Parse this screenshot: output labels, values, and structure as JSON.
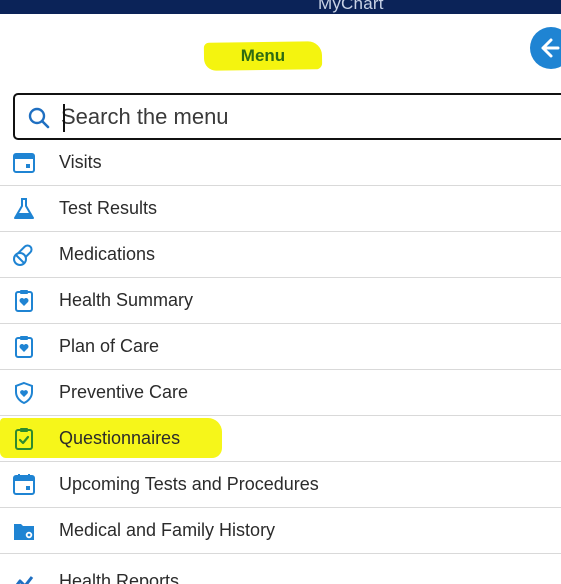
{
  "header": {
    "brand": "MyChart"
  },
  "menu": {
    "title": "Menu",
    "back_icon": "back-arrow-icon"
  },
  "search": {
    "placeholder": "Search the menu",
    "icon": "search-icon"
  },
  "items": [
    {
      "label": "Visits",
      "icon": "calendar-icon"
    },
    {
      "label": "Test Results",
      "icon": "flask-icon"
    },
    {
      "label": "Medications",
      "icon": "pills-icon"
    },
    {
      "label": "Health Summary",
      "icon": "clipboard-heart-icon"
    },
    {
      "label": "Plan of Care",
      "icon": "clipboard-heart-icon"
    },
    {
      "label": "Preventive Care",
      "icon": "shield-heart-icon"
    },
    {
      "label": "Questionnaires",
      "icon": "clipboard-check-icon",
      "highlighted": true
    },
    {
      "label": "Upcoming Tests and Procedures",
      "icon": "calendar-icon"
    },
    {
      "label": "Medical and Family History",
      "icon": "folder-icon"
    },
    {
      "label": "Health Reports",
      "icon": "chart-icon"
    }
  ],
  "colors": {
    "accent": "#1f84d3",
    "header_bg": "#0b2358",
    "highlight": "#f6f61a",
    "menu_title": "#2d6b12"
  }
}
